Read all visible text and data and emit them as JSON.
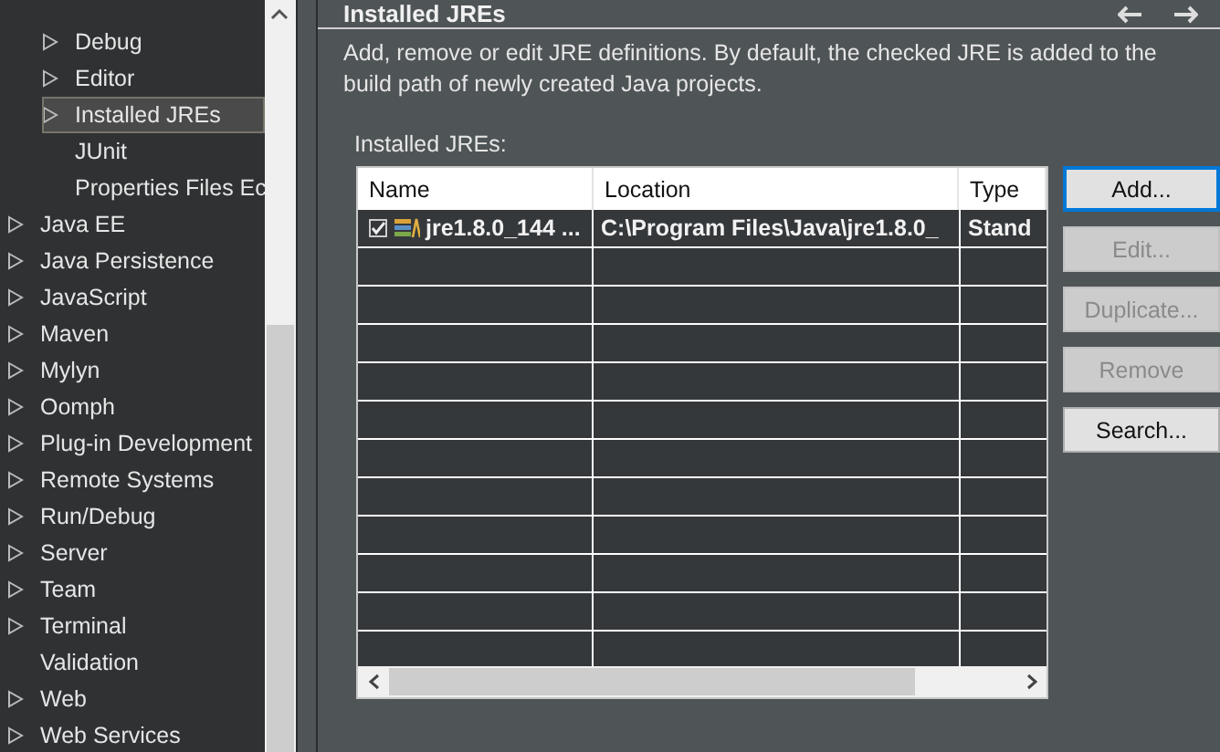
{
  "tree": {
    "items": [
      {
        "children": [
          {
            "label": "Debug",
            "expandable": true,
            "selected": false
          },
          {
            "label": "Editor",
            "expandable": true,
            "selected": false
          },
          {
            "label": "Installed JREs",
            "expandable": true,
            "selected": true
          },
          {
            "label": "JUnit",
            "expandable": false,
            "selected": false
          },
          {
            "label": "Properties Files Ec",
            "expandable": false,
            "selected": false
          }
        ]
      },
      {
        "label": "Java EE",
        "expandable": true,
        "selected": false
      },
      {
        "label": "Java Persistence",
        "expandable": true,
        "selected": false
      },
      {
        "label": "JavaScript",
        "expandable": true,
        "selected": false
      },
      {
        "label": "Maven",
        "expandable": true,
        "selected": false
      },
      {
        "label": "Mylyn",
        "expandable": true,
        "selected": false
      },
      {
        "label": "Oomph",
        "expandable": true,
        "selected": false
      },
      {
        "label": "Plug-in Development",
        "expandable": true,
        "selected": false
      },
      {
        "label": "Remote Systems",
        "expandable": true,
        "selected": false
      },
      {
        "label": "Run/Debug",
        "expandable": true,
        "selected": false
      },
      {
        "label": "Server",
        "expandable": true,
        "selected": false
      },
      {
        "label": "Team",
        "expandable": true,
        "selected": false
      },
      {
        "label": "Terminal",
        "expandable": true,
        "selected": false
      },
      {
        "label": "Validation",
        "expandable": false,
        "selected": false
      },
      {
        "label": "Web",
        "expandable": true,
        "selected": false
      },
      {
        "label": "Web Services",
        "expandable": true,
        "selected": false
      }
    ]
  },
  "page": {
    "title": "Installed JREs",
    "description": "Add, remove or edit JRE definitions. By default, the checked JRE is added to the build path of newly created Java projects.",
    "table_label": "Installed JREs:",
    "table": {
      "columns": [
        "Name",
        "Location",
        "Type"
      ],
      "rows": [
        {
          "checked": true,
          "name": "jre1.8.0_144 ...",
          "location": "C:\\Program Files\\Java\\jre1.8.0_",
          "type": "Stand"
        }
      ]
    },
    "buttons": [
      {
        "label": "Add...",
        "disabled": false,
        "focused": true
      },
      {
        "label": "Edit...",
        "disabled": true,
        "focused": false
      },
      {
        "label": "Duplicate...",
        "disabled": true,
        "focused": false
      },
      {
        "label": "Remove",
        "disabled": true,
        "focused": false
      },
      {
        "label": "Search...",
        "disabled": false,
        "focused": false
      }
    ]
  }
}
